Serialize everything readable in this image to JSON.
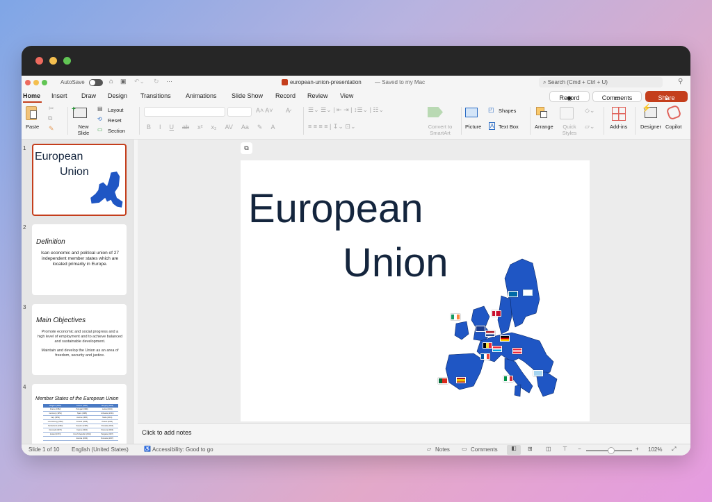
{
  "window": {
    "autosave_label": "AutoSave",
    "doc_title": "european-union-presentation",
    "save_status": "— Saved to my Mac",
    "search_placeholder": "Search (Cmd + Ctrl + U)"
  },
  "tabs": [
    "Home",
    "Insert",
    "Draw",
    "Design",
    "Transitions",
    "Animations",
    "Slide Show",
    "Record",
    "Review",
    "View"
  ],
  "active_tab": "Home",
  "actions": {
    "record": "Record",
    "comments": "Comments",
    "share": "Share"
  },
  "ribbon": {
    "paste": "Paste",
    "new_slide_1": "New",
    "new_slide_2": "Slide",
    "layout": "Layout",
    "reset": "Reset",
    "section": "Section",
    "convert_1": "Convert to",
    "convert_2": "SmartArt",
    "picture": "Picture",
    "shapes": "Shapes",
    "text_box": "Text Box",
    "arrange": "Arrange",
    "quick_styles_1": "Quick",
    "quick_styles_2": "Styles",
    "add_ins": "Add-ins",
    "designer": "Designer",
    "copilot": "Copilot",
    "font_buttons": [
      "B",
      "I",
      "U",
      "ab",
      "x²",
      "x₂",
      "AV",
      "Aa",
      "A"
    ]
  },
  "slides": [
    {
      "number": "1",
      "title_line1": "European",
      "title_line2": "Union"
    },
    {
      "number": "2",
      "title": "Definition",
      "body": "Isan economic and political union of 27 independent member states which are located primarily in Europe."
    },
    {
      "number": "3",
      "title": "Main Objectives",
      "body1": "Promote economic and social progress and a high level of employment and to achieve balanced and sustainable development.",
      "body2": "Maintain and develop the Union as an area of freedom, security and justice."
    },
    {
      "number": "4",
      "title": "Member States of the European Union",
      "table_header": [
        "Belgium (1952)",
        "Greece (1981)",
        "Hungary (2004)"
      ],
      "table_rows": [
        [
          "France (1952)",
          "Portugal (1986)",
          "Latvia (2004)"
        ],
        [
          "Germany (1952)",
          "Spain (1986)",
          "Lithuania (2004)"
        ],
        [
          "Italy (1952)",
          "Austria (1995)",
          "Malta (2004)"
        ],
        [
          "Luxembourg (1952)",
          "Finland (1995)",
          "Poland (2004)"
        ],
        [
          "Netherlands (1952)",
          "Sweden (1995)",
          "Slovakia (2004)"
        ],
        [
          "Denmark (1973)",
          "Cyprus (2004)",
          "Slovenia (2004)"
        ],
        [
          "Ireland (1973)",
          "Czech Republic (2004)",
          "Bulgaria (2007)"
        ],
        [
          "",
          "Estonia (2004)",
          "Romania (2007)"
        ]
      ]
    }
  ],
  "main_slide": {
    "title_line1": "European",
    "title_line2": "Union"
  },
  "notes_placeholder": "Click to add notes",
  "status": {
    "slide_count": "Slide 1 of 10",
    "language": "English (United States)",
    "accessibility": "Accessibility: Good to go",
    "notes": "Notes",
    "comments": "Comments",
    "zoom": "102%",
    "zoom_fraction": 0.55
  },
  "colors": {
    "accent": "#c43e1c",
    "title_text": "#14253d",
    "map_blue": "#1f56c4"
  }
}
